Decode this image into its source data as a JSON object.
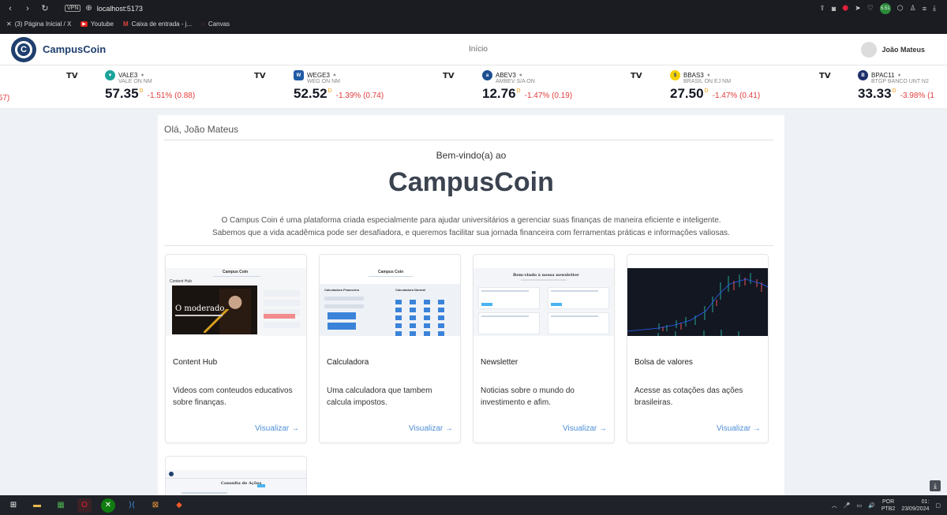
{
  "browser": {
    "url": "localhost:5173",
    "vpn_label": "VPN",
    "ext_badge": "5.51"
  },
  "bookmarks": [
    {
      "label": "(3) Página Inicial / X"
    },
    {
      "label": "Youtube"
    },
    {
      "label": "Caixa de entrada - j..."
    },
    {
      "label": "Canvas"
    }
  ],
  "header": {
    "brand": "CampusCoin",
    "nav_home": "Início",
    "user_name": "João Mateus"
  },
  "ticker": {
    "tv_logo": "TV",
    "partial_change": ".67)",
    "items": [
      {
        "symbol": "VALE3",
        "desc": "VALE ON NM",
        "price": "57.35",
        "sup": "D",
        "change": "-1.51% (0.88)",
        "color": "#1aa39a"
      },
      {
        "symbol": "WEGE3",
        "desc": "WEG ON NM",
        "price": "52.52",
        "sup": "D",
        "change": "-1.39% (0.74)",
        "color": "#1f5aa6"
      },
      {
        "symbol": "ABEV3",
        "desc": "AMBEV S/A ON",
        "price": "12.76",
        "sup": "D",
        "change": "-1.47% (0.19)",
        "color": "#1d4f8f"
      },
      {
        "symbol": "BBAS3",
        "desc": "BRASIL ON EJ NM",
        "price": "27.50",
        "sup": "D",
        "change": "-1.47% (0.41)",
        "color": "#f5d000"
      },
      {
        "symbol": "BPAC11",
        "desc": "BTGP BANCO UNT N2",
        "price": "33.33",
        "sup": "D",
        "change": "-3.98% (1",
        "color": "#1c2f6b"
      }
    ]
  },
  "main": {
    "greeting": "Olá, João Mateus",
    "welcome": "Bem-vindo(a) ao",
    "title": "CampusCoin",
    "intro_line1": "O Campus Coin é uma plataforma criada especialmente para ajudar universitários a gerenciar suas finanças de maneira eficiente e inteligente.",
    "intro_line2": "Sabemos que a vida acadêmica pode ser desafiadora, e queremos facilitar sua jornada financeira com ferramentas práticas e informações valiosas."
  },
  "cards": [
    {
      "title": "Content Hub",
      "desc": "Videos com conteudos educativos sobre finanças.",
      "link": "Visualizar →",
      "mini_title": "Campus Coin",
      "mini_sub": "Content Hub",
      "video_text": "O moderado"
    },
    {
      "title": "Calculadora",
      "desc": "Uma calculadora que tambem calcula impostos.",
      "link": "Visualizar →",
      "mini_title": "Campus Coin",
      "mini_left": "Calculadora Financeira",
      "mini_right": "Calculadora Normal"
    },
    {
      "title": "Newsletter",
      "desc": "Noticias sobre o mundo do investimento e afim.",
      "link": "Visualizar →",
      "mini_title": "Bem-vindo à nossa newsletter"
    },
    {
      "title": "Bolsa de valores",
      "desc": "Acesse as cotações das ações brasileiras.",
      "link": "Visualizar →"
    }
  ],
  "card5": {
    "mini_title": "Consulta de Ações"
  },
  "taskbar": {
    "lang1": "POR",
    "lang2": "PTB2",
    "time": "01:",
    "date": "23/09/2024"
  }
}
